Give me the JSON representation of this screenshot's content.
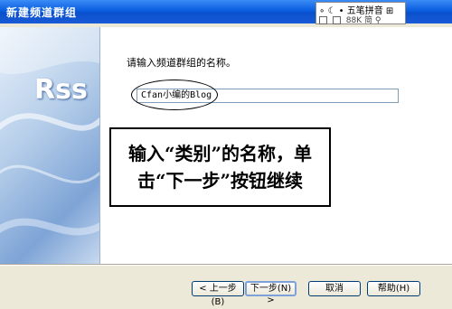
{
  "window": {
    "title": "新建频道群组"
  },
  "ime": {
    "mode_label": "五笔拼音",
    "row1_prefix": "∘",
    "row2_items": [
      "88K",
      "简"
    ]
  },
  "banner": {
    "logo_text": "Rss"
  },
  "form": {
    "prompt": "请输入频道群组的名称。",
    "name_value": "Cfan小编的Blog"
  },
  "callout": {
    "line1": "输入“类别”的名称，单",
    "line2": "击“下一步”按钮继续"
  },
  "buttons": {
    "back": "< 上一步(B)",
    "next": "下一步(N) >",
    "cancel": "取消",
    "help": "帮助(H)"
  },
  "colors": {
    "titlebar": "#0a5ee0",
    "dialog_bg": "#ece9d8",
    "banner": "#7ea4d6"
  }
}
